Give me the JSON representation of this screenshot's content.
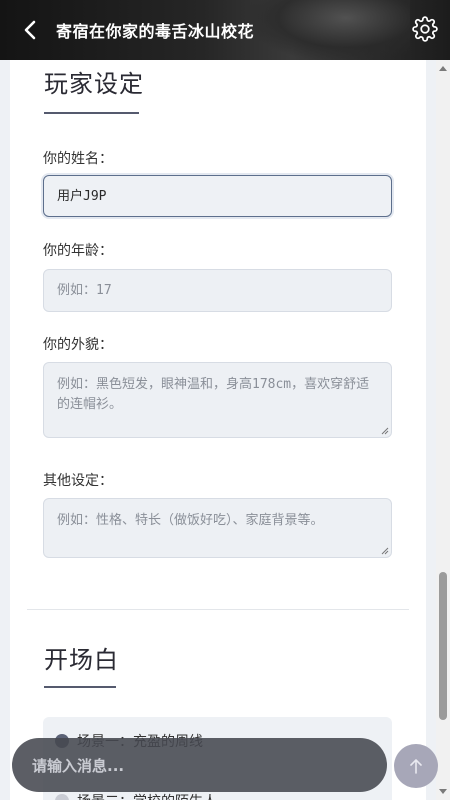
{
  "header": {
    "title": "寄宿在你家的毒舌冰山校花"
  },
  "player_settings": {
    "section_title": "玩家设定",
    "name": {
      "label": "你的姓名：",
      "value": "用户J9P"
    },
    "age": {
      "label": "你的年龄：",
      "placeholder": "例如：17"
    },
    "appearance": {
      "label": "你的外貌：",
      "placeholder": "例如：黑色短发，眼神温和，身高178cm，喜欢穿舒适的连帽衫。"
    },
    "other": {
      "label": "其他设定：",
      "placeholder": "例如：性格、特长（做饭好吃）、家庭背景等。"
    }
  },
  "opening": {
    "section_title": "开场白",
    "scenes": [
      {
        "label": "场景一：充盈的周线"
      },
      {
        "label": "场景二：学校的陌生人"
      }
    ]
  },
  "composer": {
    "placeholder": "请输入消息..."
  },
  "colors": {
    "accent": "#5d6f8c",
    "send_button": "#a7a7b8"
  }
}
